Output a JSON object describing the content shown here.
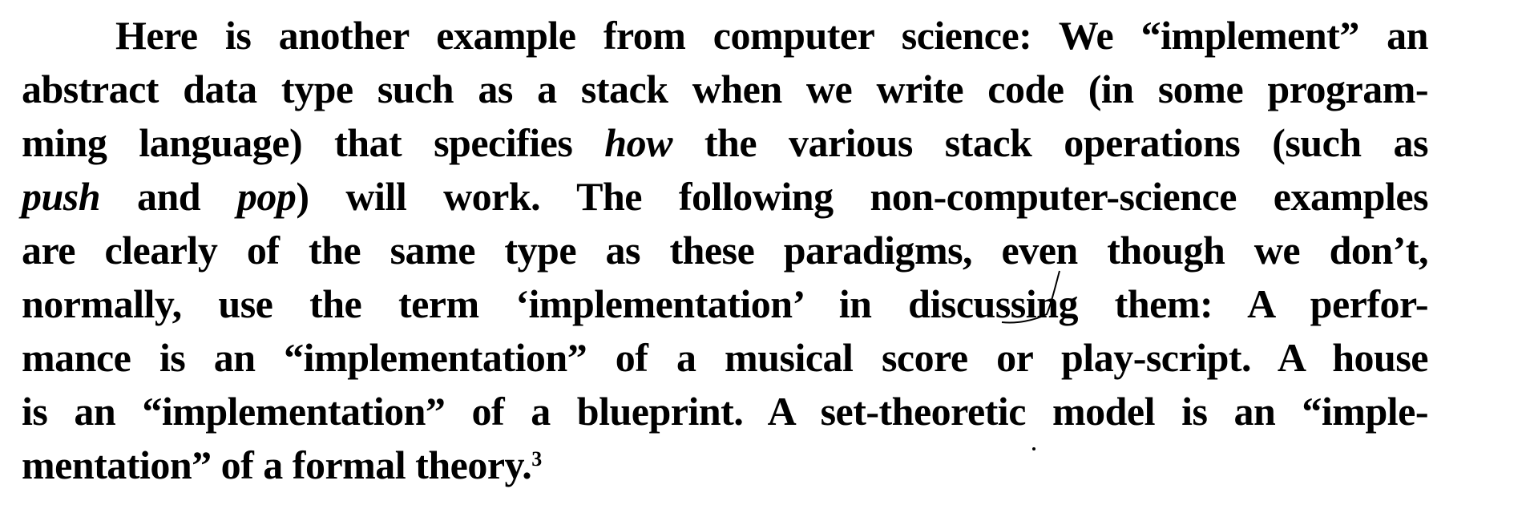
{
  "paragraph": {
    "lines": [
      "Here is another example from computer science: We “implement” an",
      "abstract data type such as a stack when we write code (in some program-",
      {
        "a": "ming language) that specifies ",
        "b": "how",
        "c": " the various stack operations (such as"
      },
      {
        "a": "push",
        "b": " and ",
        "c": "pop",
        "d": ") will work. The following non-computer-science examples"
      },
      "are clearly of the same type as these paradigms, even though we don’t,",
      "normally, use the term ‘implementation’ in discussing them: A perfor-",
      "mance is an “implementation” of a musical score or play-script. A house",
      "is an “implementation” of a blueprint. A set-theoretic model is an “imple-",
      {
        "a": "mentation” of a formal theory.",
        "footnote": "3"
      }
    ]
  }
}
